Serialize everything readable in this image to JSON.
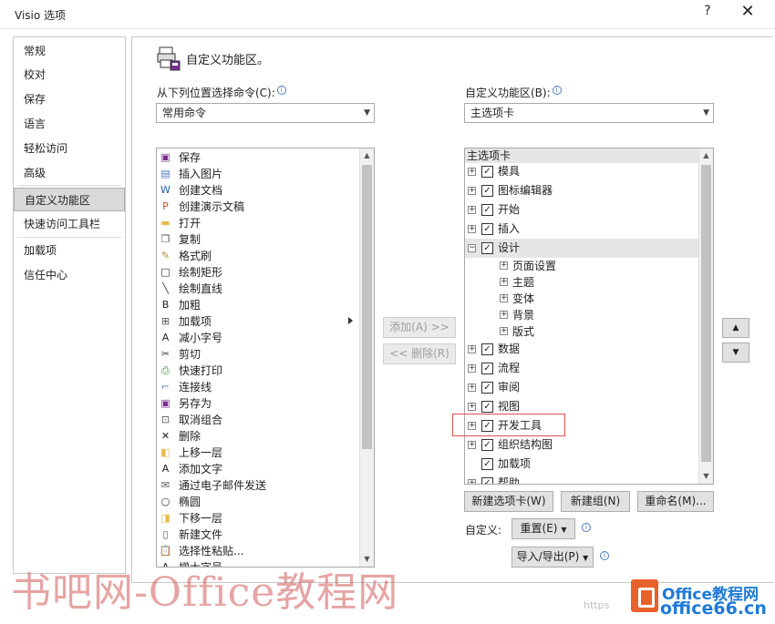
{
  "window": {
    "title": "Visio 选项",
    "help": "?",
    "close": "✕"
  },
  "nav": {
    "items": [
      "常规",
      "校对",
      "保存",
      "语言",
      "轻松访问",
      "高级",
      "自定义功能区",
      "快速访问工具栏",
      "加载项",
      "信任中心"
    ],
    "selected_index": 6
  },
  "header": {
    "title": "自定义功能区。"
  },
  "left": {
    "label": "从下列位置选择命令(C):",
    "combo_value": "常用命令",
    "commands": [
      {
        "label": "保存",
        "icon": "save-icon",
        "glyph": "▣",
        "color": "#7a2f8f"
      },
      {
        "label": "插入图片",
        "icon": "picture-icon",
        "glyph": "▤",
        "color": "#4a7cc0"
      },
      {
        "label": "创建文档",
        "icon": "word-icon",
        "glyph": "W",
        "color": "#2b5cab"
      },
      {
        "label": "创建演示文稿",
        "icon": "powerpoint-icon",
        "glyph": "P",
        "color": "#d24726"
      },
      {
        "label": "打开",
        "icon": "folder-icon",
        "glyph": "▬",
        "color": "#e8b84a"
      },
      {
        "label": "复制",
        "icon": "copy-icon",
        "glyph": "❐",
        "color": "#555555"
      },
      {
        "label": "格式刷",
        "icon": "format-painter-icon",
        "glyph": "✎",
        "color": "#c08a30"
      },
      {
        "label": "绘制矩形",
        "icon": "rectangle-icon",
        "glyph": "□",
        "color": "#333333"
      },
      {
        "label": "绘制直线",
        "icon": "line-icon",
        "glyph": "╲",
        "color": "#333333"
      },
      {
        "label": "加粗",
        "icon": "bold-icon",
        "glyph": "B",
        "color": "#222222"
      },
      {
        "label": "加载项",
        "icon": "addins-icon",
        "glyph": "⊞",
        "color": "#555555",
        "submenu": true
      },
      {
        "label": "减小字号",
        "icon": "font-decrease-icon",
        "glyph": "A",
        "color": "#222222"
      },
      {
        "label": "剪切",
        "icon": "cut-icon",
        "glyph": "✂",
        "color": "#333333"
      },
      {
        "label": "快速打印",
        "icon": "quick-print-icon",
        "glyph": "⎙",
        "color": "#3a8a3a"
      },
      {
        "label": "连接线",
        "icon": "connector-icon",
        "glyph": "⌐",
        "color": "#4a7cc0"
      },
      {
        "label": "另存为",
        "icon": "save-as-icon",
        "glyph": "▣",
        "color": "#7a2f8f"
      },
      {
        "label": "取消组合",
        "icon": "ungroup-icon",
        "glyph": "⊡",
        "color": "#555555"
      },
      {
        "label": "删除",
        "icon": "delete-icon",
        "glyph": "✕",
        "color": "#222222"
      },
      {
        "label": "上移一层",
        "icon": "bring-forward-icon",
        "glyph": "◧",
        "color": "#e8b84a"
      },
      {
        "label": "添加文字",
        "icon": "text-icon",
        "glyph": "A",
        "color": "#222222"
      },
      {
        "label": "通过电子邮件发送",
        "icon": "email-attach-icon",
        "glyph": "✉",
        "color": "#555555"
      },
      {
        "label": "椭圆",
        "icon": "ellipse-icon",
        "glyph": "○",
        "color": "#333333"
      },
      {
        "label": "下移一层",
        "icon": "send-backward-icon",
        "glyph": "◨",
        "color": "#e8b84a"
      },
      {
        "label": "新建文件",
        "icon": "new-file-icon",
        "glyph": "▯",
        "color": "#555555"
      },
      {
        "label": "选择性粘贴...",
        "icon": "paste-special-icon",
        "glyph": "📋",
        "color": "#555555"
      },
      {
        "label": "增大字号",
        "icon": "font-increase-icon",
        "glyph": "A",
        "color": "#222222"
      }
    ]
  },
  "middle": {
    "add_label": "添加(A) >>",
    "remove_label": "<< 删除(R)"
  },
  "right": {
    "label": "自定义功能区(B):",
    "combo_value": "主选项卡",
    "tree_header": "主选项卡",
    "tree": [
      {
        "label": "模具",
        "level": 0,
        "pm": "+",
        "checked": true
      },
      {
        "label": "图标编辑器",
        "level": 0,
        "pm": "+",
        "checked": true
      },
      {
        "label": "开始",
        "level": 0,
        "pm": "+",
        "checked": true
      },
      {
        "label": "插入",
        "level": 0,
        "pm": "+",
        "checked": true
      },
      {
        "label": "设计",
        "level": 0,
        "pm": "−",
        "checked": true,
        "selected": true
      },
      {
        "label": "页面设置",
        "level": 1,
        "pm": "+"
      },
      {
        "label": "主题",
        "level": 1,
        "pm": "+"
      },
      {
        "label": "变体",
        "level": 1,
        "pm": "+"
      },
      {
        "label": "背景",
        "level": 1,
        "pm": "+"
      },
      {
        "label": "版式",
        "level": 1,
        "pm": "+"
      },
      {
        "label": "数据",
        "level": 0,
        "pm": "+",
        "checked": true
      },
      {
        "label": "流程",
        "level": 0,
        "pm": "+",
        "checked": true
      },
      {
        "label": "审阅",
        "level": 0,
        "pm": "+",
        "checked": true
      },
      {
        "label": "视图",
        "level": 0,
        "pm": "+",
        "checked": true
      },
      {
        "label": "开发工具",
        "level": 0,
        "pm": "+",
        "checked": true
      },
      {
        "label": "组织结构图",
        "level": 0,
        "pm": "+",
        "checked": true
      },
      {
        "label": "加载项",
        "level": 0,
        "pm": "",
        "checked": true
      },
      {
        "label": "帮助",
        "level": 0,
        "pm": "+",
        "checked": true
      }
    ],
    "new_tab": "新建选项卡(W)",
    "new_group": "新建组(N)",
    "rename": "重命名(M)...",
    "customize_label": "自定义:",
    "reset": "重置(E)",
    "import_export": "导入/导出(P)"
  },
  "watermark": {
    "text": "书吧网-Office教程网",
    "logo_line1": "Office教程网",
    "logo_line2": "office66.cn",
    "url_fragment": "https"
  }
}
